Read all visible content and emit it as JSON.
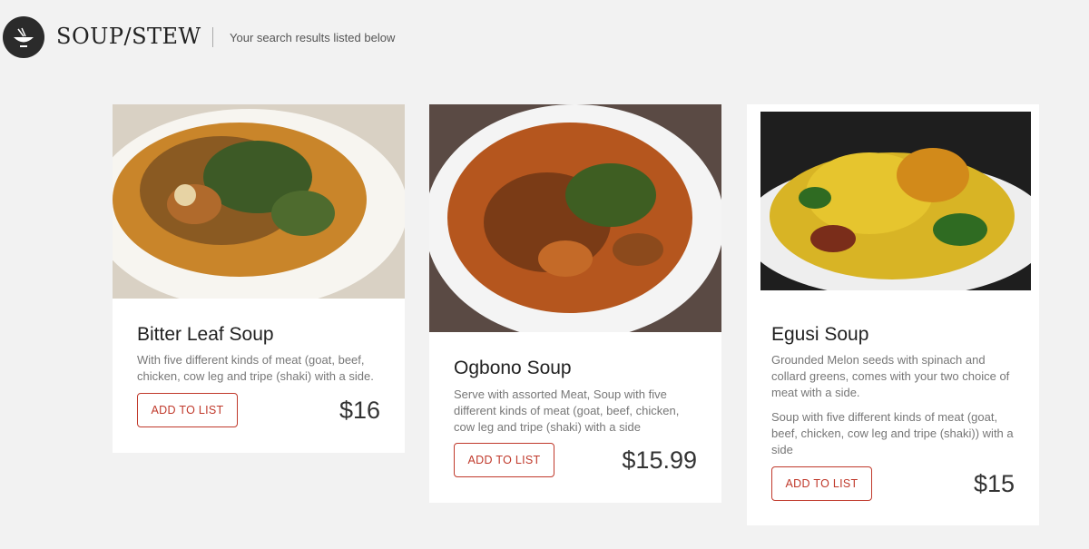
{
  "header": {
    "logo_icon": "soup-bowl-icon",
    "brand": "SOUP/STEW",
    "subtitle": "Your search results listed below"
  },
  "colors": {
    "accent": "#c0392b",
    "background": "#f2f2f2",
    "card": "#ffffff"
  },
  "cards": [
    {
      "name": "Bitter Leaf Soup",
      "desc": "With five different kinds of meat (goat, beef, chicken, cow leg and tripe (shaki) with a side.",
      "button": "ADD TO LIST",
      "price": "$16"
    },
    {
      "name": "Ogbono Soup",
      "desc": "Serve with assorted Meat, Soup with five different kinds of meat (goat, beef, chicken, cow leg and tripe (shaki) with a side",
      "button": "ADD TO LIST",
      "price": "$15.99"
    },
    {
      "name": "Egusi Soup",
      "desc": "Grounded Melon seeds with spinach and collard greens, comes with your two choice of meat with a side.",
      "desc2": "Soup with five different kinds of meat (goat, beef, chicken, cow leg and tripe (shaki)) with a side",
      "button": "ADD TO LIST",
      "price": "$15"
    }
  ]
}
